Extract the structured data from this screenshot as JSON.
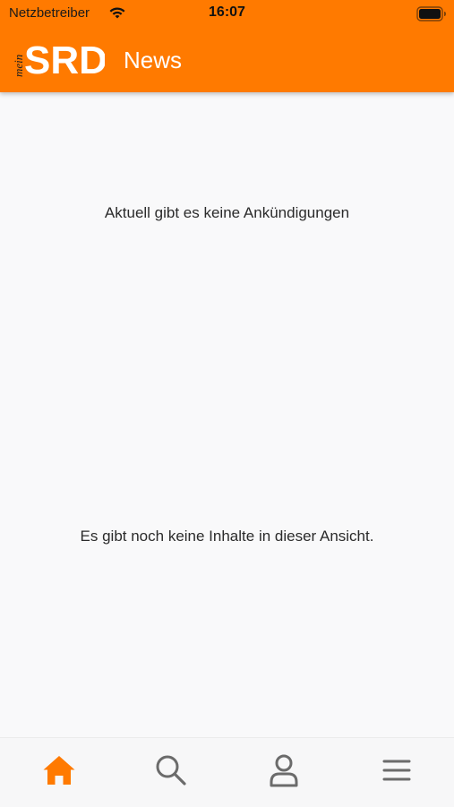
{
  "status_bar": {
    "carrier": "Netzbetreiber",
    "time": "16:07"
  },
  "header": {
    "logo_prefix": "mein",
    "logo_text": "SRD",
    "title": "News"
  },
  "main": {
    "announcements_empty": "Aktuell gibt es keine Ankündigungen",
    "content_empty": "Es gibt noch keine Inhalte in dieser Ansicht."
  },
  "tab_bar": {
    "items": [
      {
        "icon": "home-icon",
        "active": true
      },
      {
        "icon": "search-icon",
        "active": false
      },
      {
        "icon": "profile-icon",
        "active": false
      },
      {
        "icon": "menu-icon",
        "active": false
      }
    ]
  },
  "colors": {
    "accent": "#ff7a00",
    "icon_inactive": "#6b6b6b",
    "text": "#2b2b2b",
    "background": "#f9f9fa"
  }
}
